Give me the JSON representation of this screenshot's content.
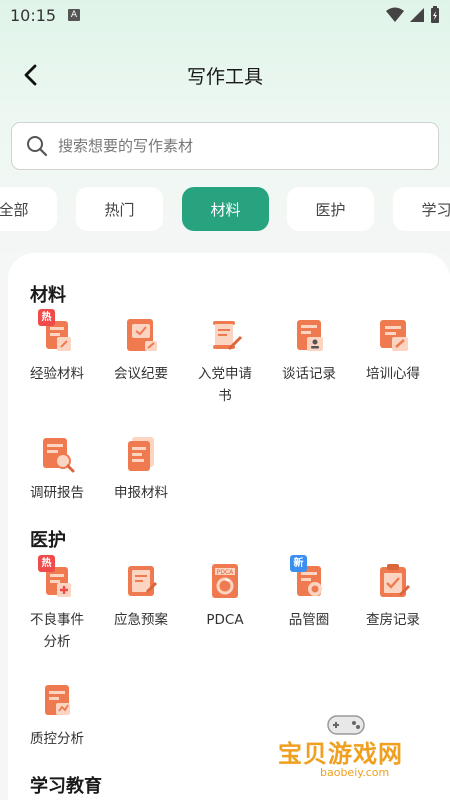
{
  "status": {
    "time": "10:15",
    "notif": "A"
  },
  "header": {
    "title": "写作工具"
  },
  "search": {
    "placeholder": "搜索想要的写作素材"
  },
  "tabs": [
    "全部",
    "热门",
    "材料",
    "医护",
    "学习"
  ],
  "active_tab": "材料",
  "sections": [
    {
      "title": "材料",
      "items": [
        "经验材料",
        "会议纪要",
        "入党申请",
        "书",
        "谈话记录",
        "培训心得",
        "调研报告",
        "申报材料"
      ]
    },
    {
      "title": "医护",
      "items": [
        "不良事件",
        "分析",
        "应急预案",
        "PDCA",
        "品管圈",
        "查房记录",
        "质控分析"
      ]
    },
    {
      "title": "学习教育"
    }
  ],
  "badges": {
    "hot": "热",
    "new": "新"
  },
  "watermark": {
    "text": "宝贝游戏网",
    "url": "baobeiy.com"
  },
  "colors": {
    "accent": "#27a37f",
    "icon_orange": "#f07a4f",
    "icon_light": "#fbd4c2",
    "badge_hot": "#ef4b4b",
    "badge_new": "#3a8ff0"
  }
}
